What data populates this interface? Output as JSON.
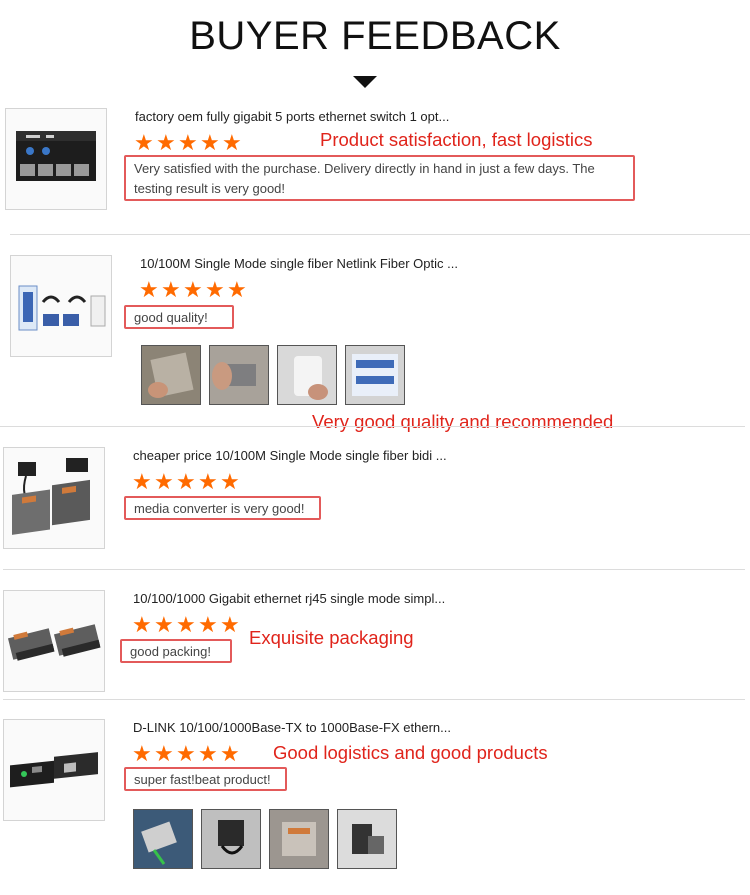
{
  "header": {
    "title": "BUYER FEEDBACK"
  },
  "colors": {
    "star": "#ff6a00",
    "annotation": "#e0241b",
    "box_border": "#e35a5a"
  },
  "reviews": [
    {
      "product": "factory oem fully gigabit 5 ports ethernet switch 1 opt...",
      "stars": 5,
      "comment": "Very satisfied with the purchase. Delivery directly in hand in just a few days. The testing result is very good!",
      "annotation": "Product satisfaction, fast logistics",
      "photos": []
    },
    {
      "product": "10/100M Single Mode single fiber Netlink Fiber Optic ...",
      "stars": 5,
      "comment": "good quality!",
      "annotation": "Very good quality and recommended",
      "photos": [
        "photo-1",
        "photo-2",
        "photo-3",
        "photo-4"
      ]
    },
    {
      "product": "cheaper price 10/100M Single Mode single fiber bidi ...",
      "stars": 5,
      "comment": "media converter is very good!",
      "annotation": "",
      "photos": []
    },
    {
      "product": "10/100/1000 Gigabit ethernet rj45 single mode simpl...",
      "stars": 5,
      "comment": "good packing!",
      "annotation": "Exquisite packaging",
      "photos": []
    },
    {
      "product": "D-LINK 10/100/1000Base-TX to 1000Base-FX ethern...",
      "stars": 5,
      "comment": "super fast!beat product!",
      "annotation": "Good logistics and good products",
      "photos": [
        "photo-1",
        "photo-2",
        "photo-3",
        "photo-4"
      ]
    }
  ]
}
